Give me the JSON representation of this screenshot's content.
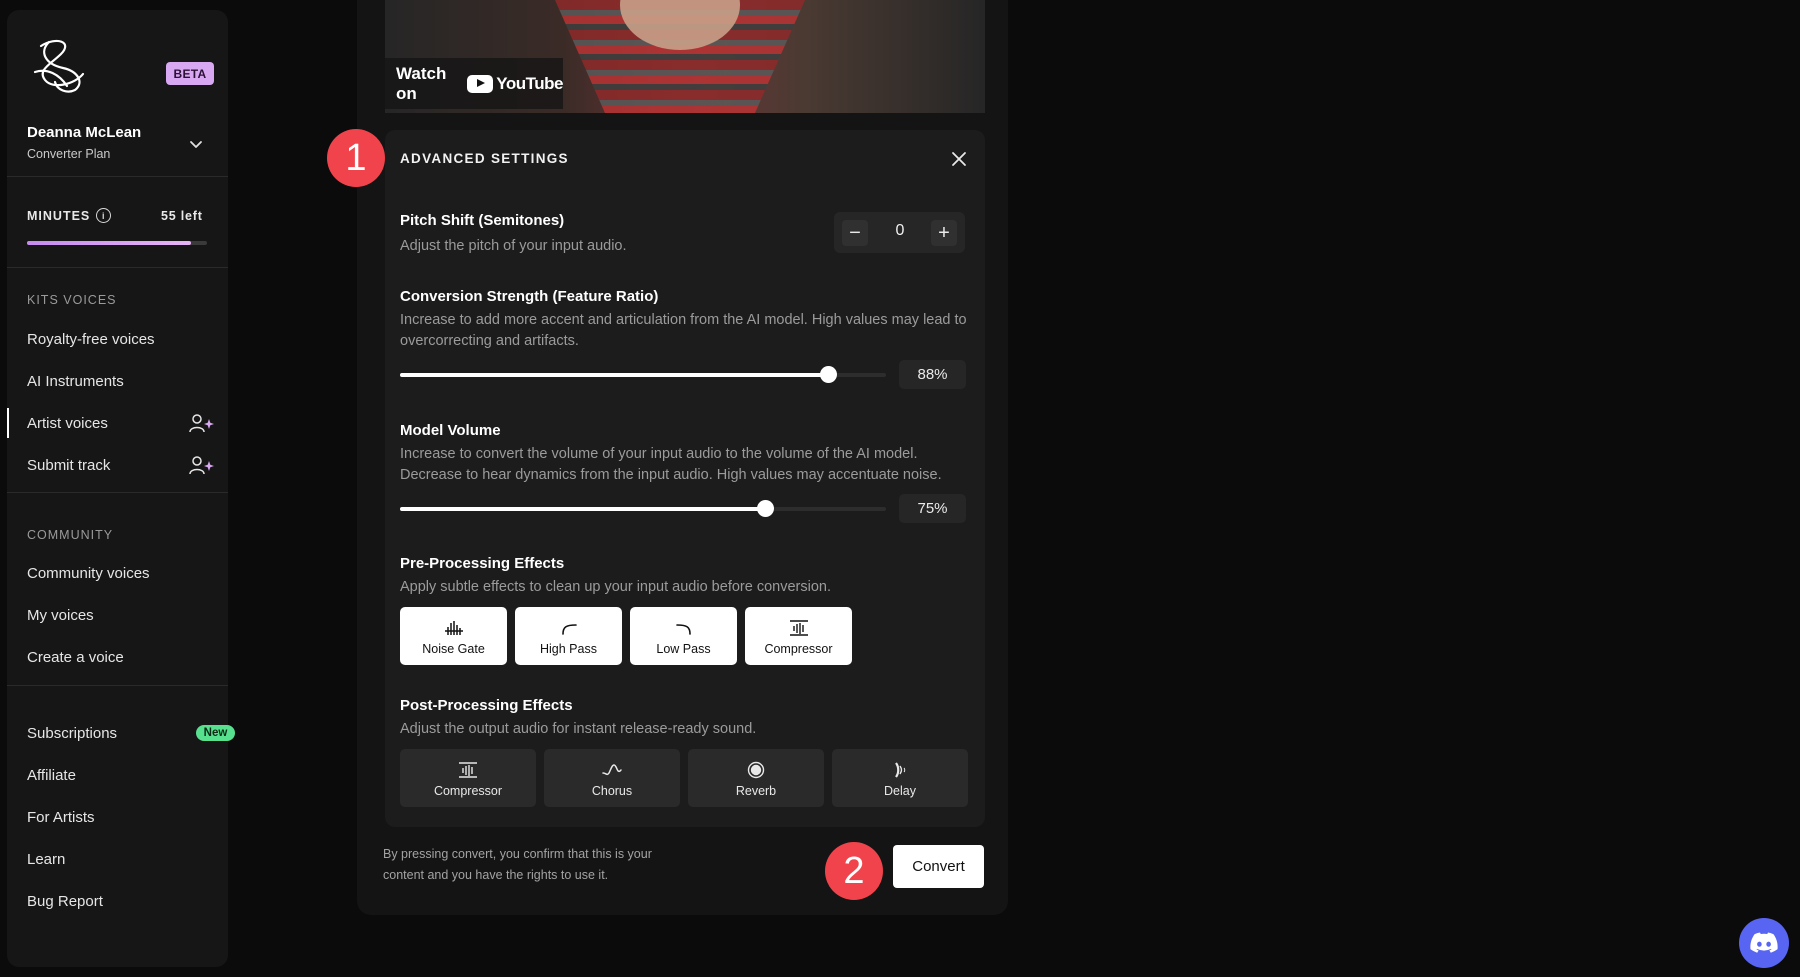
{
  "sidebar": {
    "beta_label": "BETA",
    "user": {
      "name": "Deanna McLean",
      "plan": "Converter Plan"
    },
    "minutes": {
      "label": "MINUTES",
      "info_glyph": "i",
      "left": "55 left",
      "progress_percent": 91
    },
    "kits_section": {
      "label": "KITS VOICES",
      "items": [
        {
          "label": "Royalty-free voices"
        },
        {
          "label": "AI Instruments"
        },
        {
          "label": "Artist voices",
          "active": true,
          "icon": "user-sparkle-icon"
        },
        {
          "label": "Submit track",
          "icon": "user-sparkle-icon"
        }
      ]
    },
    "community_section": {
      "label": "COMMUNITY",
      "items": [
        {
          "label": "Community voices"
        },
        {
          "label": "My voices"
        },
        {
          "label": "Create a voice"
        }
      ]
    },
    "footer_items": [
      {
        "label": "Subscriptions",
        "badge": "New"
      },
      {
        "label": "Affiliate"
      },
      {
        "label": "For Artists"
      },
      {
        "label": "Learn"
      },
      {
        "label": "Bug Report"
      }
    ]
  },
  "video": {
    "watch_label": "Watch on",
    "platform": "YouTube"
  },
  "callouts": {
    "first": "1",
    "second": "2"
  },
  "settings": {
    "title": "ADVANCED SETTINGS",
    "pitch": {
      "title": "Pitch Shift (Semitones)",
      "description": "Adjust the pitch of your input audio.",
      "value": "0",
      "minus": "−",
      "plus": "+"
    },
    "strength": {
      "title": "Conversion Strength (Feature Ratio)",
      "description": "Increase to add more accent and articulation from the AI model. High values may lead to overcorrecting and artifacts.",
      "value_label": "88%",
      "value": 88
    },
    "volume": {
      "title": "Model Volume",
      "description": "Increase to convert the volume of your input audio to the volume of the AI model. Decrease to hear dynamics from the input audio. High values may accentuate noise.",
      "value_label": "75%",
      "value": 75
    },
    "pre": {
      "title": "Pre-Processing Effects",
      "description": "Apply subtle effects to clean up your input audio before conversion.",
      "effects": [
        {
          "label": "Noise Gate",
          "icon": "noise-gate-icon"
        },
        {
          "label": "High Pass",
          "icon": "high-pass-icon"
        },
        {
          "label": "Low Pass",
          "icon": "low-pass-icon"
        },
        {
          "label": "Compressor",
          "icon": "compressor-icon"
        }
      ]
    },
    "post": {
      "title": "Post-Processing Effects",
      "description": "Adjust the output audio for instant release-ready sound.",
      "effects": [
        {
          "label": "Compressor",
          "icon": "compressor-icon"
        },
        {
          "label": "Chorus",
          "icon": "chorus-icon"
        },
        {
          "label": "Reverb",
          "icon": "reverb-icon"
        },
        {
          "label": "Delay",
          "icon": "delay-icon"
        }
      ]
    }
  },
  "footer": {
    "disclaimer": "By pressing convert, you confirm that this is your content and you have the rights to use it.",
    "convert_label": "Convert"
  },
  "colors": {
    "accent_purple": "#d9a8f2",
    "new_badge": "#57e08e",
    "callout_red": "#f0434b",
    "discord": "#5865f2"
  }
}
